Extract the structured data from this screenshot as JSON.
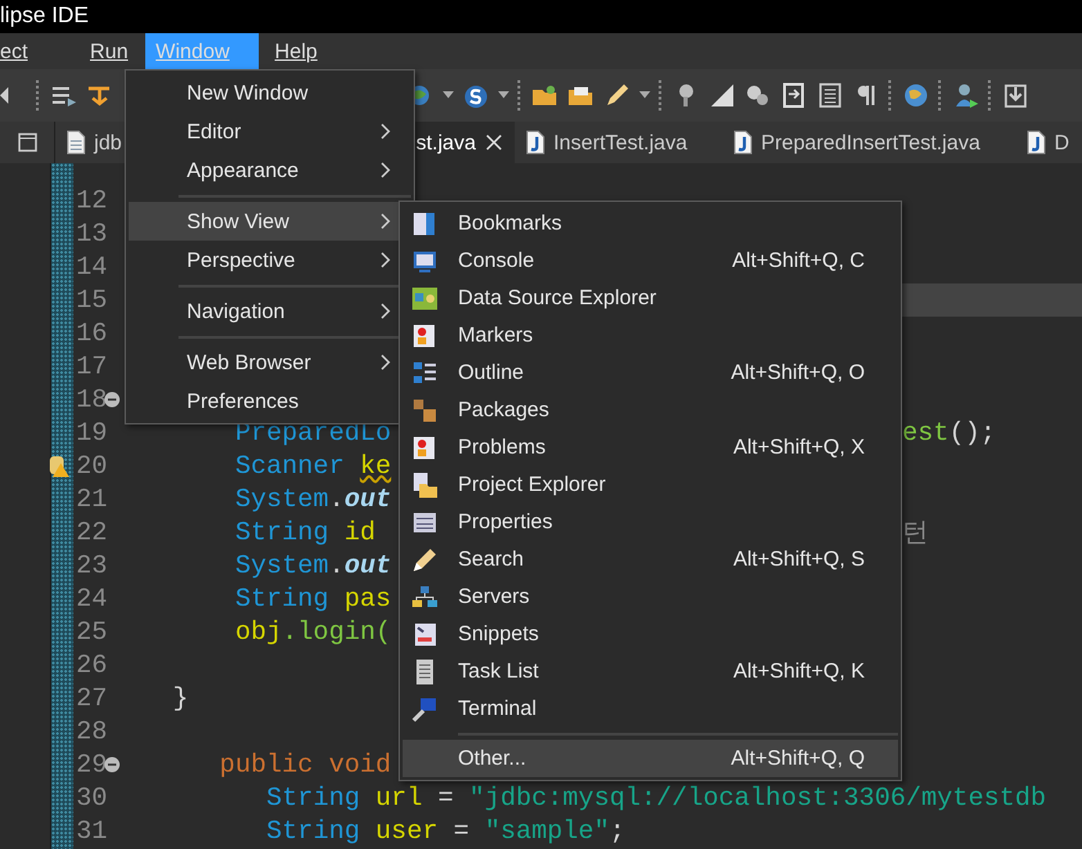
{
  "window": {
    "title": "lipse IDE"
  },
  "menubar": [
    {
      "label": "ect",
      "selected": false
    },
    {
      "label": "Run",
      "selected": false
    },
    {
      "label": "Window",
      "selected": true
    },
    {
      "label": "Help",
      "selected": false
    }
  ],
  "tabs": [
    {
      "label": "jdb",
      "kind": "text",
      "selected": false
    },
    {
      "label": "st.java",
      "kind": "hidden",
      "selected": true
    },
    {
      "label": "InsertTest.java",
      "kind": "java",
      "selected": false
    },
    {
      "label": "PreparedInsertTest.java",
      "kind": "java",
      "selected": false
    },
    {
      "label": "D",
      "kind": "java",
      "selected": false
    }
  ],
  "editor": {
    "lines": [
      {
        "number": "12",
        "kind": "blank",
        "current": false,
        "fold": false,
        "warning": false
      },
      {
        "number": "13",
        "kind": "blank",
        "current": false,
        "fold": false,
        "warning": false
      },
      {
        "number": "14",
        "kind": "blank",
        "current": false,
        "fold": false,
        "warning": false
      },
      {
        "number": "15",
        "kind": "blank",
        "current": true,
        "fold": false,
        "warning": false
      },
      {
        "number": "16",
        "kind": "blank",
        "current": false,
        "fold": false,
        "warning": false
      },
      {
        "number": "17",
        "kind": "blank",
        "current": false,
        "fold": false,
        "warning": false
      },
      {
        "number": "18",
        "kind": "blank",
        "current": false,
        "fold": true,
        "warning": false
      },
      {
        "number": "19",
        "kind": "statement",
        "current": false,
        "fold": false,
        "warning": false,
        "tokens": [
          {
            "text": "PreparedLo",
            "kind": "type"
          }
        ],
        "right": [
          {
            "text": "est",
            "kind": "method"
          },
          {
            "text": "();",
            "kind": "joined"
          }
        ]
      },
      {
        "number": "20",
        "kind": "statement",
        "current": false,
        "fold": false,
        "warning": true,
        "tokens": [
          {
            "text": "Scanner",
            "kind": "type"
          },
          {
            "text": "ke",
            "kind": "warned"
          }
        ]
      },
      {
        "number": "21",
        "kind": "statement",
        "current": false,
        "fold": false,
        "warning": false,
        "tokens": [
          {
            "text": "System",
            "kind": "type"
          },
          {
            "text": ".",
            "kind": "joined"
          },
          {
            "text": "out",
            "kind": "member"
          }
        ]
      },
      {
        "number": "22",
        "kind": "statement",
        "current": false,
        "fold": false,
        "warning": false,
        "tokens": [
          {
            "text": "String",
            "kind": "type"
          },
          {
            "text": "id",
            "kind": "var"
          }
        ],
        "right": [
          {
            "text": "턴",
            "kind": "comment"
          }
        ]
      },
      {
        "number": "23",
        "kind": "statement",
        "current": false,
        "fold": false,
        "warning": false,
        "tokens": [
          {
            "text": "System",
            "kind": "type"
          },
          {
            "text": ".",
            "kind": "joined"
          },
          {
            "text": "out",
            "kind": "member"
          }
        ]
      },
      {
        "number": "24",
        "kind": "statement",
        "current": false,
        "fold": false,
        "warning": false,
        "tokens": [
          {
            "text": "String",
            "kind": "type"
          },
          {
            "text": "pas",
            "kind": "var"
          }
        ]
      },
      {
        "number": "25",
        "kind": "statement",
        "current": false,
        "fold": false,
        "warning": false,
        "tokens": [
          {
            "text": "obj",
            "kind": "var"
          },
          {
            "text": ".login(",
            "kind": "call"
          }
        ]
      },
      {
        "number": "26",
        "kind": "blank",
        "current": false,
        "fold": false,
        "warning": false
      },
      {
        "number": "27",
        "kind": "block_end",
        "current": false,
        "fold": false,
        "warning": false,
        "tokens": [
          {
            "text": "}",
            "kind": "plain"
          }
        ]
      },
      {
        "number": "28",
        "kind": "blank",
        "current": false,
        "fold": false,
        "warning": false
      },
      {
        "number": "29",
        "kind": "method",
        "current": false,
        "fold": true,
        "warning": false,
        "tokens": [
          {
            "text": "public void",
            "kind": "keyword"
          }
        ]
      },
      {
        "number": "30",
        "kind": "method_body",
        "current": false,
        "fold": false,
        "warning": false,
        "tokens": [
          {
            "text": "String",
            "kind": "type"
          },
          {
            "text": "url",
            "kind": "var"
          },
          {
            "text": "=",
            "kind": "plain"
          },
          {
            "text": "\"jdbc:mysql://localhost:3306/mytestdb",
            "kind": "string"
          }
        ]
      },
      {
        "number": "31",
        "kind": "method_body",
        "current": false,
        "fold": false,
        "warning": false,
        "tokens": [
          {
            "text": "String",
            "kind": "type"
          },
          {
            "text": "user",
            "kind": "var"
          },
          {
            "text": "=",
            "kind": "plain"
          },
          {
            "text": "\"sample\"",
            "kind": "string"
          },
          {
            "text": ";",
            "kind": "joined"
          }
        ]
      }
    ]
  },
  "window_menu": [
    {
      "kind": "item",
      "label": "New Window",
      "submenu": false,
      "selected": false
    },
    {
      "kind": "item",
      "label": "Editor",
      "submenu": true,
      "selected": false
    },
    {
      "kind": "item",
      "label": "Appearance",
      "submenu": true,
      "selected": false
    },
    {
      "kind": "separator"
    },
    {
      "kind": "item",
      "label": "Show View",
      "submenu": true,
      "selected": true
    },
    {
      "kind": "item",
      "label": "Perspective",
      "submenu": true,
      "selected": false
    },
    {
      "kind": "separator"
    },
    {
      "kind": "item",
      "label": "Navigation",
      "submenu": true,
      "selected": false
    },
    {
      "kind": "separator"
    },
    {
      "kind": "item",
      "label": "Web Browser",
      "submenu": true,
      "selected": false
    },
    {
      "kind": "item",
      "label": "Preferences",
      "submenu": false,
      "selected": false
    }
  ],
  "show_view_menu": [
    {
      "kind": "item",
      "label": "Bookmarks",
      "selected": false
    },
    {
      "kind": "item",
      "label": "Console",
      "shortcut": "Alt+Shift+Q, C",
      "selected": false
    },
    {
      "kind": "item",
      "label": "Data Source Explorer",
      "selected": false
    },
    {
      "kind": "item",
      "label": "Markers",
      "selected": false
    },
    {
      "kind": "item",
      "label": "Outline",
      "shortcut": "Alt+Shift+Q, O",
      "selected": false
    },
    {
      "kind": "item",
      "label": "Packages",
      "selected": false
    },
    {
      "kind": "item",
      "label": "Problems",
      "shortcut": "Alt+Shift+Q, X",
      "selected": false
    },
    {
      "kind": "item",
      "label": "Project Explorer",
      "selected": false
    },
    {
      "kind": "item",
      "label": "Properties",
      "selected": false
    },
    {
      "kind": "item",
      "label": "Search",
      "shortcut": "Alt+Shift+Q, S",
      "selected": false
    },
    {
      "kind": "item",
      "label": "Servers",
      "selected": false
    },
    {
      "kind": "item",
      "label": "Snippets",
      "selected": false
    },
    {
      "kind": "item",
      "label": "Task List",
      "shortcut": "Alt+Shift+Q, K",
      "selected": false
    },
    {
      "kind": "item",
      "label": "Terminal",
      "selected": false
    },
    {
      "kind": "separator"
    },
    {
      "kind": "item",
      "label": "Other...",
      "shortcut": "Alt+Shift+Q, Q",
      "selected": true
    }
  ]
}
